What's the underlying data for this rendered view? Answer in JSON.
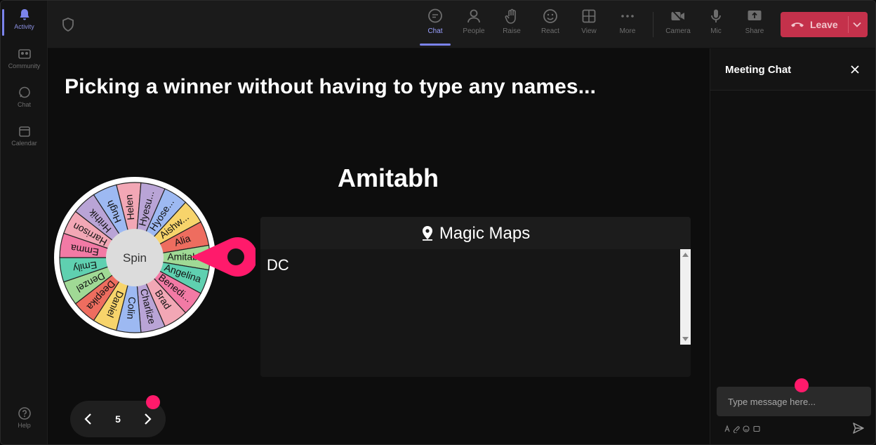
{
  "rail": {
    "items": [
      {
        "label": "Activity",
        "icon": "bell-icon",
        "active": true
      },
      {
        "label": "Community",
        "icon": "community-icon"
      },
      {
        "label": "Chat",
        "icon": "chat-icon"
      },
      {
        "label": "Calendar",
        "icon": "calendar-icon"
      },
      {
        "label": "Help",
        "icon": "help-icon"
      }
    ]
  },
  "toolbar": {
    "chat": "Chat",
    "people": "People",
    "raise": "Raise",
    "react": "React",
    "view": "View",
    "more": "More",
    "camera": "Camera",
    "mic": "Mic",
    "share": "Share",
    "leave": "Leave"
  },
  "stage": {
    "headline": "Picking a winner without having to type any names...",
    "winner": "Amitabh",
    "spin_label": "Spin",
    "wheel_names": [
      "Helen",
      "Hyesu...",
      "Hyose...",
      "Aishw...",
      "Alia",
      "Amitabh",
      "Angelina",
      "Benedi...",
      "Brad",
      "Charlize",
      "Colin",
      "Daniel",
      "Deepika",
      "Denzel",
      "Emily",
      "Emma",
      "Harrison",
      "Hrithik",
      "Hugh"
    ],
    "maps_title": "Magic Maps",
    "maps_value": "DC",
    "page_number": "5"
  },
  "chat": {
    "title": "Meeting Chat",
    "placeholder": "Type message here..."
  },
  "colors": {
    "accent": "#7b83eb",
    "leave": "#c4314b",
    "pink": "#ff1a6b",
    "wheel": [
      "#f2a7b5",
      "#b9a4d6",
      "#9db9f2",
      "#f7d46b",
      "#ee6d5f",
      "#a0d995",
      "#5fd0b0",
      "#f27aa5"
    ]
  }
}
